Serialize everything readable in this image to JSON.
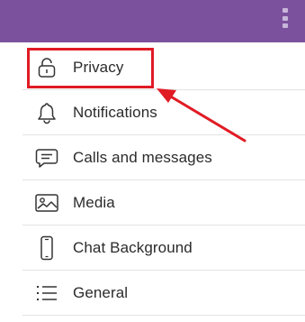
{
  "topbar": {
    "menu_icon": "more-vertical-icon",
    "color": "#7b519d"
  },
  "settings": {
    "items": [
      {
        "label": "Privacy",
        "icon": "lock-icon"
      },
      {
        "label": "Notifications",
        "icon": "bell-icon"
      },
      {
        "label": "Calls and messages",
        "icon": "chat-bubble-icon"
      },
      {
        "label": "Media",
        "icon": "image-icon"
      },
      {
        "label": "Chat Background",
        "icon": "phone-icon"
      },
      {
        "label": "General",
        "icon": "list-icon"
      }
    ]
  },
  "annotation": {
    "highlight_color": "#e01b24",
    "arrow_color": "#e01b24",
    "highlighted_item": "Privacy"
  }
}
